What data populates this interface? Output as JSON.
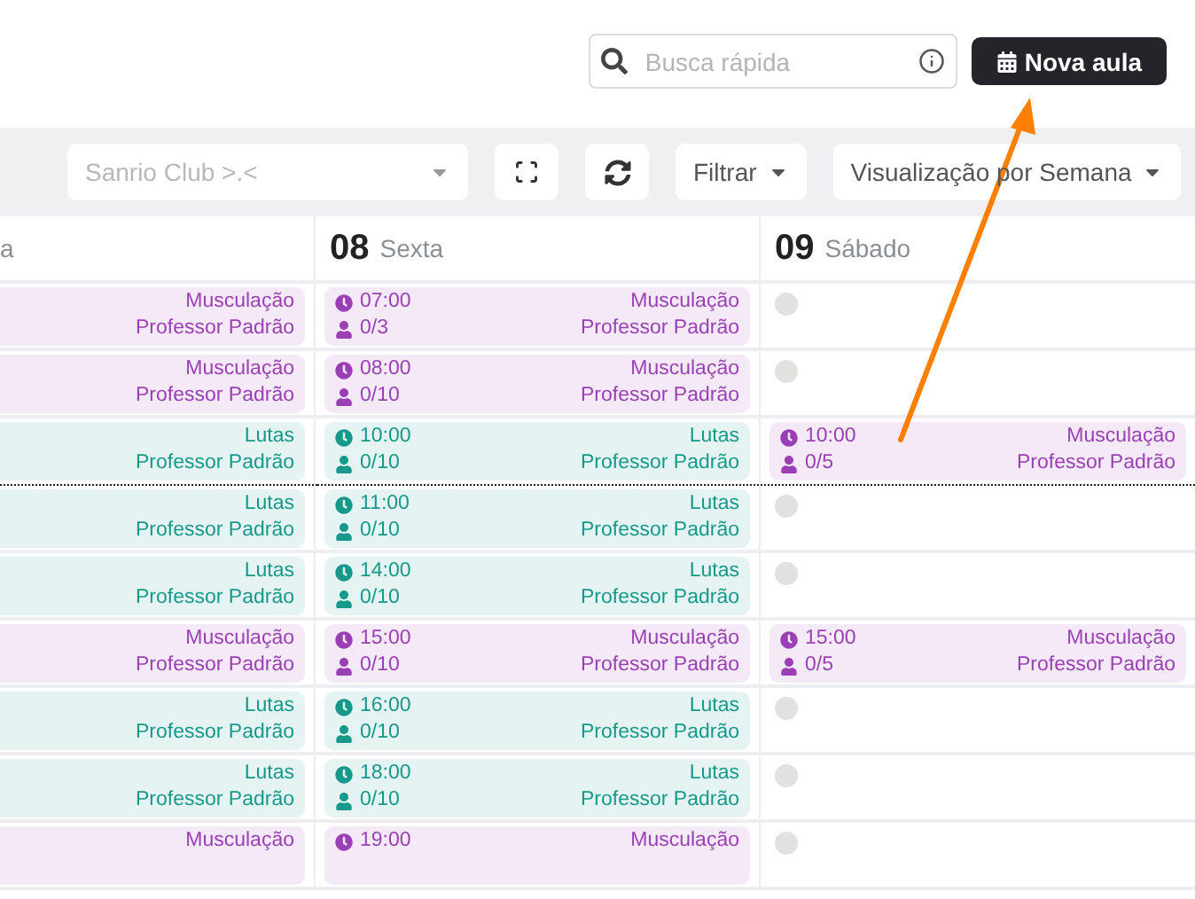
{
  "search": {
    "placeholder": "Busca rápida"
  },
  "new_button": {
    "label": "Nova aula"
  },
  "toolbar": {
    "club_select": {
      "value": "Sanrio Club >.<"
    },
    "filter_button": {
      "label": "Filtrar"
    },
    "view_button": {
      "label": "Visualização por Semana"
    }
  },
  "days": [
    {
      "name": "a"
    },
    {
      "number": "08",
      "name": "Sexta"
    },
    {
      "number": "09",
      "name": "Sábado"
    }
  ],
  "rows": [
    {
      "current_time_line": false,
      "cells": [
        {
          "kind": "class",
          "category": "Musculação",
          "teacher": "Professor Padrão",
          "color": "#9b3fb5"
        },
        {
          "kind": "class",
          "time": "07:00",
          "capacity": "0/3",
          "category": "Musculação",
          "teacher": "Professor Padrão",
          "color": "#9b3fb5"
        },
        {
          "kind": "empty"
        }
      ]
    },
    {
      "current_time_line": false,
      "cells": [
        {
          "kind": "class",
          "category": "Musculação",
          "teacher": "Professor Padrão",
          "color": "#9b3fb5"
        },
        {
          "kind": "class",
          "time": "08:00",
          "capacity": "0/10",
          "category": "Musculação",
          "teacher": "Professor Padrão",
          "color": "#9b3fb5"
        },
        {
          "kind": "empty"
        }
      ]
    },
    {
      "current_time_line": true,
      "cells": [
        {
          "kind": "class",
          "category": "Lutas",
          "teacher": "Professor Padrão",
          "color": "#16998a"
        },
        {
          "kind": "class",
          "time": "10:00",
          "capacity": "0/10",
          "category": "Lutas",
          "teacher": "Professor Padrão",
          "color": "#16998a"
        },
        {
          "kind": "class",
          "time": "10:00",
          "capacity": "0/5",
          "category": "Musculação",
          "teacher": "Professor Padrão",
          "color": "#9b3fb5"
        }
      ]
    },
    {
      "current_time_line": false,
      "cells": [
        {
          "kind": "class",
          "category": "Lutas",
          "teacher": "Professor Padrão",
          "color": "#16998a"
        },
        {
          "kind": "class",
          "time": "11:00",
          "capacity": "0/10",
          "category": "Lutas",
          "teacher": "Professor Padrão",
          "color": "#16998a"
        },
        {
          "kind": "empty"
        }
      ]
    },
    {
      "current_time_line": false,
      "cells": [
        {
          "kind": "class",
          "category": "Lutas",
          "teacher": "Professor Padrão",
          "color": "#16998a"
        },
        {
          "kind": "class",
          "time": "14:00",
          "capacity": "0/10",
          "category": "Lutas",
          "teacher": "Professor Padrão",
          "color": "#16998a"
        },
        {
          "kind": "empty"
        }
      ]
    },
    {
      "current_time_line": false,
      "cells": [
        {
          "kind": "class",
          "category": "Musculação",
          "teacher": "Professor Padrão",
          "color": "#9b3fb5"
        },
        {
          "kind": "class",
          "time": "15:00",
          "capacity": "0/10",
          "category": "Musculação",
          "teacher": "Professor Padrão",
          "color": "#9b3fb5"
        },
        {
          "kind": "class",
          "time": "15:00",
          "capacity": "0/5",
          "category": "Musculação",
          "teacher": "Professor Padrão",
          "color": "#9b3fb5"
        }
      ]
    },
    {
      "current_time_line": false,
      "cells": [
        {
          "kind": "class",
          "category": "Lutas",
          "teacher": "Professor Padrão",
          "color": "#16998a"
        },
        {
          "kind": "class",
          "time": "16:00",
          "capacity": "0/10",
          "category": "Lutas",
          "teacher": "Professor Padrão",
          "color": "#16998a"
        },
        {
          "kind": "empty"
        }
      ]
    },
    {
      "current_time_line": false,
      "cells": [
        {
          "kind": "class",
          "category": "Lutas",
          "teacher": "Professor Padrão",
          "color": "#16998a"
        },
        {
          "kind": "class",
          "time": "18:00",
          "capacity": "0/10",
          "category": "Lutas",
          "teacher": "Professor Padrão",
          "color": "#16998a"
        },
        {
          "kind": "empty"
        }
      ]
    },
    {
      "current_time_line": false,
      "cells": [
        {
          "kind": "class",
          "category": "Musculação",
          "color": "#9b3fb5"
        },
        {
          "kind": "class",
          "time": "19:00",
          "category": "Musculação",
          "color": "#9b3fb5"
        },
        {
          "kind": "empty"
        }
      ]
    }
  ]
}
